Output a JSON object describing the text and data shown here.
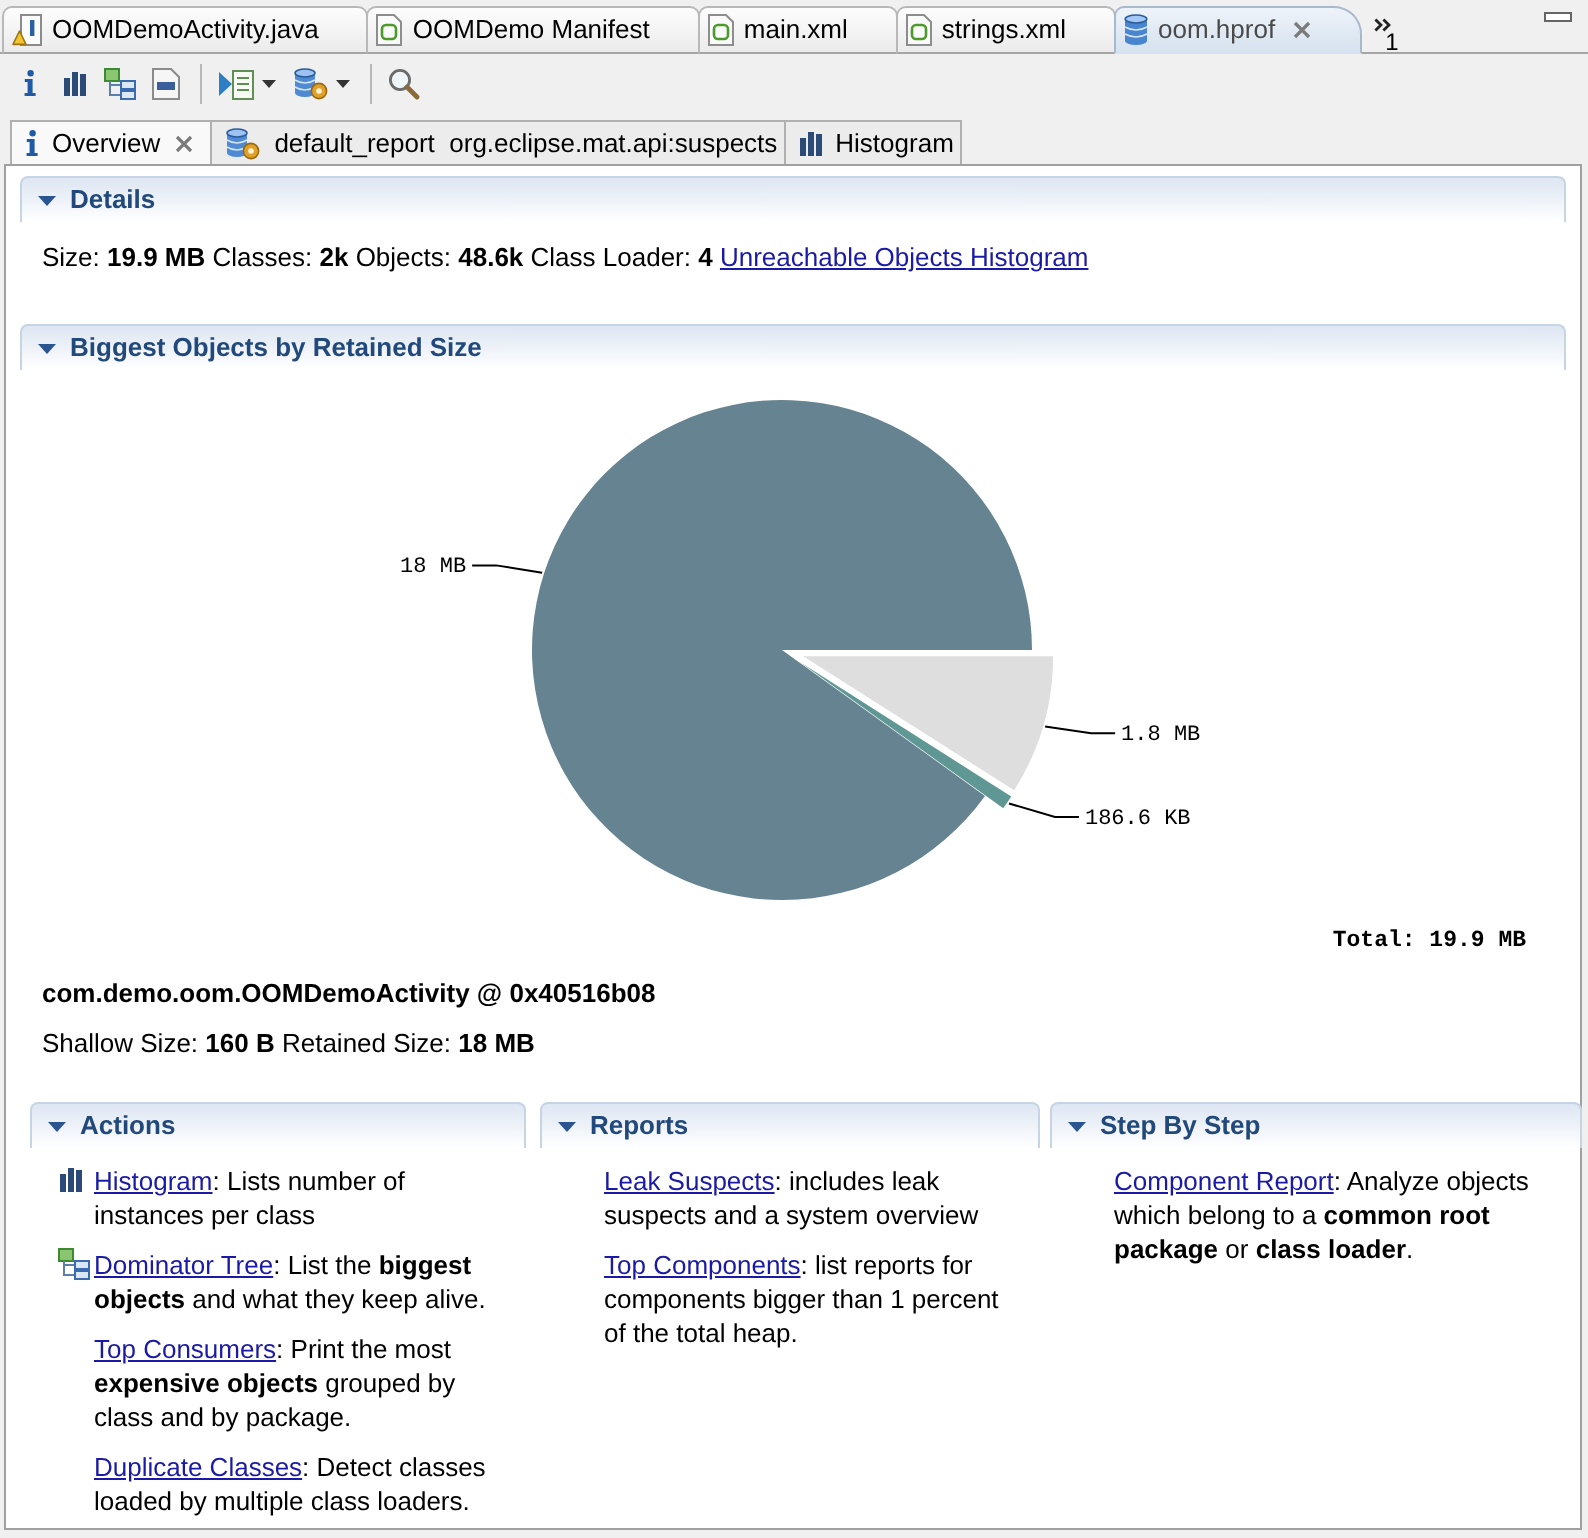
{
  "editor_tabs": [
    {
      "label": "OOMDemoActivity.java",
      "kind": "java",
      "warning": true,
      "selected": false
    },
    {
      "label": "OOMDemo Manifest",
      "kind": "android_xml",
      "warning": false,
      "selected": false
    },
    {
      "label": "main.xml",
      "kind": "android_xml",
      "warning": false,
      "selected": false
    },
    {
      "label": "strings.xml",
      "kind": "android_xml",
      "warning": false,
      "selected": false
    },
    {
      "label": "oom.hprof",
      "kind": "heap_dump",
      "warning": false,
      "selected": true
    }
  ],
  "hidden_tabs_count": "1",
  "view_tabs": [
    {
      "label": "Overview",
      "kind": "info",
      "selected": true
    },
    {
      "label": "default_report  org.eclipse.mat.api:suspects",
      "kind": "report",
      "selected": false
    },
    {
      "label": "Histogram",
      "kind": "histogram",
      "selected": false
    }
  ],
  "details": {
    "title": "Details",
    "expanded": true,
    "summary": "Size: **19.9 MB** Classes: **2k** Objects: **48.6k** Class Loader: **4**",
    "link": "Unreachable Objects Histogram"
  },
  "biggest_objects": {
    "title": "Biggest Objects by Retained Size",
    "expanded": true,
    "chart_data": {
      "type": "pie",
      "values": [
        90.08,
        0.91,
        9.01
      ],
      "colors": [
        "#668391",
        "#5f9794",
        "#dedede"
      ],
      "annotations": [
        "Total: 19.9 MB"
      ]
    },
    "slice_labels": [
      "18 MB",
      "186.6 KB",
      "1.8 MB"
    ],
    "object_name": "com.demo.oom.OOMDemoActivity @ 0x40516b08",
    "object_sizes": "Shallow Size: **160 B** Retained Size: **18 MB**"
  },
  "panels": [
    {
      "title": "Actions",
      "expanded": true,
      "items": [
        {
          "kind": "histogram",
          "link": "Histogram",
          "text": ": Lists number of instances per class"
        },
        {
          "kind": "dominator_tree",
          "link": "Dominator Tree",
          "text": ": List the **biggest objects** and what they keep alive."
        },
        {
          "kind": "plain",
          "link": "Top Consumers",
          "text": ": Print the most **expensive objects** grouped by class and by package."
        },
        {
          "kind": "plain",
          "link": "Duplicate Classes",
          "text": ": Detect classes loaded by multiple class loaders."
        }
      ]
    },
    {
      "title": "Reports",
      "expanded": true,
      "items": [
        {
          "kind": "plain",
          "link": "Leak Suspects",
          "text": ": includes leak suspects and a system overview"
        },
        {
          "kind": "plain",
          "link": "Top Components",
          "text": ": list reports for components bigger than 1 percent of the total heap."
        }
      ]
    },
    {
      "title": "Step By Step",
      "expanded": true,
      "items": [
        {
          "kind": "plain",
          "link": "Component Report",
          "text": ": Analyze objects which belong to a **common root package** or **class loader**."
        }
      ]
    }
  ]
}
